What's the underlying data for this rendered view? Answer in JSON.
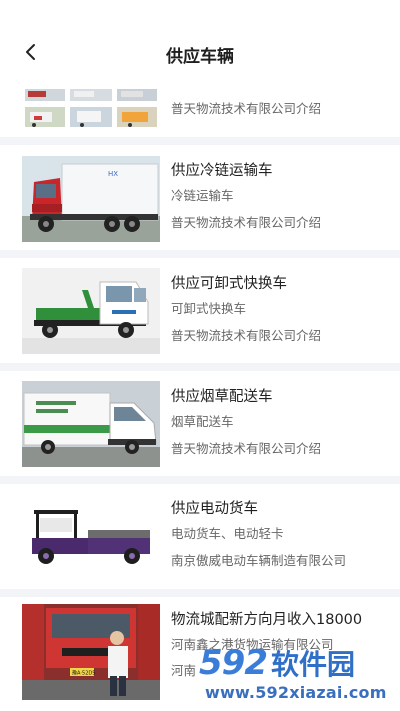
{
  "header": {
    "title": "供应车辆"
  },
  "items": [
    {
      "title": "",
      "subtitle": "",
      "company": "普天物流技术有限公司介绍"
    },
    {
      "title": "供应冷链运输车",
      "subtitle": "冷链运输车",
      "company": "普天物流技术有限公司介绍"
    },
    {
      "title": "供应可卸式快换车",
      "subtitle": "可卸式快换车",
      "company": "普天物流技术有限公司介绍"
    },
    {
      "title": "供应烟草配送车",
      "subtitle": "烟草配送车",
      "company": "普天物流技术有限公司介绍"
    },
    {
      "title": "供应电动货车",
      "subtitle": "电动货车、电动轻卡",
      "company": "南京傲威电动车辆制造有限公司"
    },
    {
      "title": "物流城配新方向月收入18000",
      "subtitle": "河南鑫之港货物运输有限公司",
      "company": "河南"
    }
  ],
  "truck_texts": {
    "reefer_brand": "HX",
    "license_plate": "豫A·52D5"
  },
  "watermark": {
    "brand_num": "592",
    "brand_cn": "软件园",
    "url": "www.592xiazai.com"
  },
  "colors": {
    "accent": "#3a7dd8",
    "background": "#f2f4f8"
  }
}
